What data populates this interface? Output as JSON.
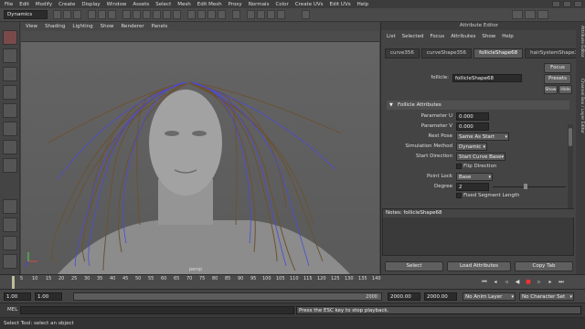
{
  "menubar": {
    "items": [
      "File",
      "Edit",
      "Modify",
      "Create",
      "Display",
      "Window",
      "Assets",
      "Select",
      "Mesh",
      "Edit Mesh",
      "Proxy",
      "Normals",
      "Color",
      "Create UVs",
      "Edit UVs",
      "Help"
    ]
  },
  "status": {
    "mode": "Dynamics"
  },
  "viewport": {
    "menu": [
      "View",
      "Shading",
      "Lighting",
      "Show",
      "Renderer",
      "Panels"
    ],
    "camera_label": "persp"
  },
  "attr_editor": {
    "title": "Attribute Editor",
    "menu": [
      "List",
      "Selected",
      "Focus",
      "Attributes",
      "Show",
      "Help"
    ],
    "tabs": [
      "curve356",
      "curveShape356",
      "follicleShape68",
      "hairSystemShape1"
    ],
    "active_tab": 2,
    "object_label": "follicle:",
    "object_value": "follicleShape68",
    "focus_btn": "Focus",
    "presets_btn": "Presets",
    "show_btn": "Show",
    "hide_btn": "Hide",
    "section_title": "Follicle Attributes",
    "rows": [
      {
        "label": "Parameter U",
        "value": "0.000"
      },
      {
        "label": "Parameter V",
        "value": "0.000"
      }
    ],
    "rest_pose_label": "Rest Pose",
    "rest_pose_value": "Same As Start",
    "sim_method_label": "Simulation Method",
    "sim_method_value": "Dynamic",
    "start_dir_label": "Start Direction",
    "start_dir_value": "Start Curve Base",
    "flip_dir_label": "Flip Direction",
    "point_lock_label": "Point Lock",
    "point_lock_value": "Base",
    "degree_label": "Degree",
    "degree_value": "2",
    "fixed_seg_label": "Fixed Segment Length",
    "notes_label": "Notes:",
    "notes_obj": "follicleShape68",
    "select_btn": "Select",
    "load_btn": "Load Attributes",
    "copy_btn": "Copy Tab"
  },
  "right_tabs": [
    "Attribute Editor",
    "Channel Box / Layer Editor"
  ],
  "timeline": {
    "ticks": [
      "5",
      "10",
      "15",
      "20",
      "25",
      "30",
      "35",
      "40",
      "45",
      "50",
      "55",
      "60",
      "65",
      "70",
      "75",
      "80",
      "85",
      "90",
      "95",
      "100",
      "105",
      "110",
      "115",
      "120",
      "125",
      "130",
      "135",
      "140"
    ],
    "current_frame": "1.00"
  },
  "range": {
    "start": "1.00",
    "start2": "1.00",
    "end": "2000",
    "end_total": "2000.00",
    "end_total2": "2000.00",
    "anim_layer": "No Anim Layer",
    "char_set": "No Character Set"
  },
  "cmdline": {
    "lang": "MEL",
    "message": "Press the ESC key to stop playback."
  },
  "helpline": {
    "text": "Select Tool: select an object"
  },
  "colors": {
    "hair_brown": "#6b5233",
    "hair_blue": "#4b4bd6",
    "skin": "#9a9a9a"
  }
}
